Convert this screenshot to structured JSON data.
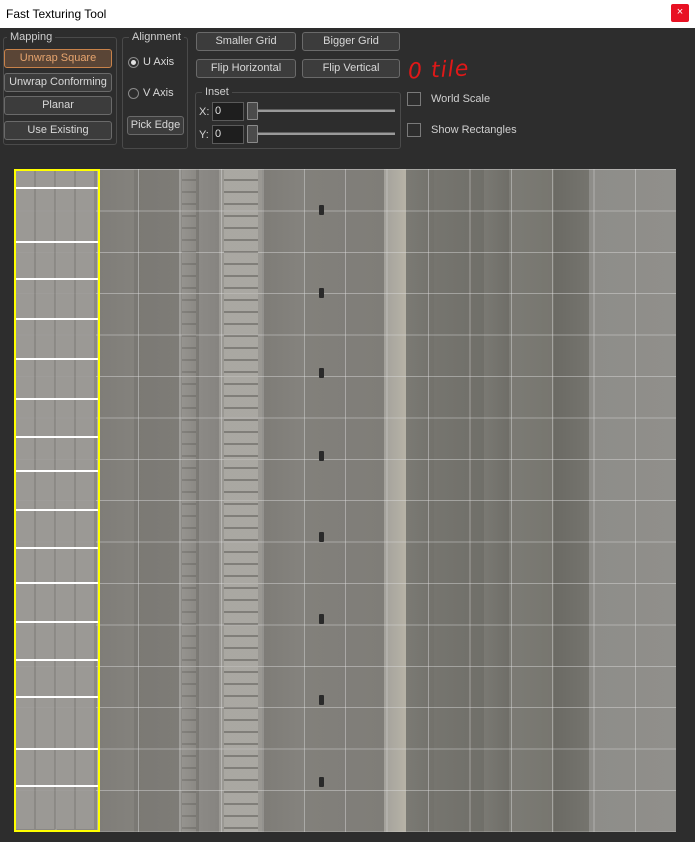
{
  "window": {
    "title": "Fast Texturing Tool",
    "close_glyph": "×"
  },
  "mapping": {
    "label": "Mapping",
    "buttons": [
      {
        "label": "Unwrap Square",
        "active": true
      },
      {
        "label": "Unwrap Conforming",
        "active": false
      },
      {
        "label": "Planar",
        "active": false
      },
      {
        "label": "Use Existing",
        "active": false
      }
    ]
  },
  "alignment": {
    "label": "Alignment",
    "u_axis": "U Axis",
    "v_axis": "V Axis",
    "selected": "U Axis",
    "pick_edge": "Pick Edge"
  },
  "grid_buttons": {
    "smaller_grid": "Smaller Grid",
    "bigger_grid": "Bigger Grid",
    "flip_horizontal": "Flip Horizontal",
    "flip_vertical": "Flip Vertical"
  },
  "inset": {
    "label": "Inset",
    "x_label": "X:",
    "x_value": "0",
    "y_label": "Y:",
    "y_value": "0"
  },
  "options": {
    "world_scale": {
      "label": "World Scale",
      "checked": false
    },
    "show_rectangles": {
      "label": "Show Rectangles",
      "checked": false
    }
  },
  "annotation": {
    "text": "0 tile",
    "color": "#e01818"
  },
  "colors": {
    "background": "#2d2d2d",
    "active_accent": "#c8824a",
    "selection": "#ffff00"
  }
}
